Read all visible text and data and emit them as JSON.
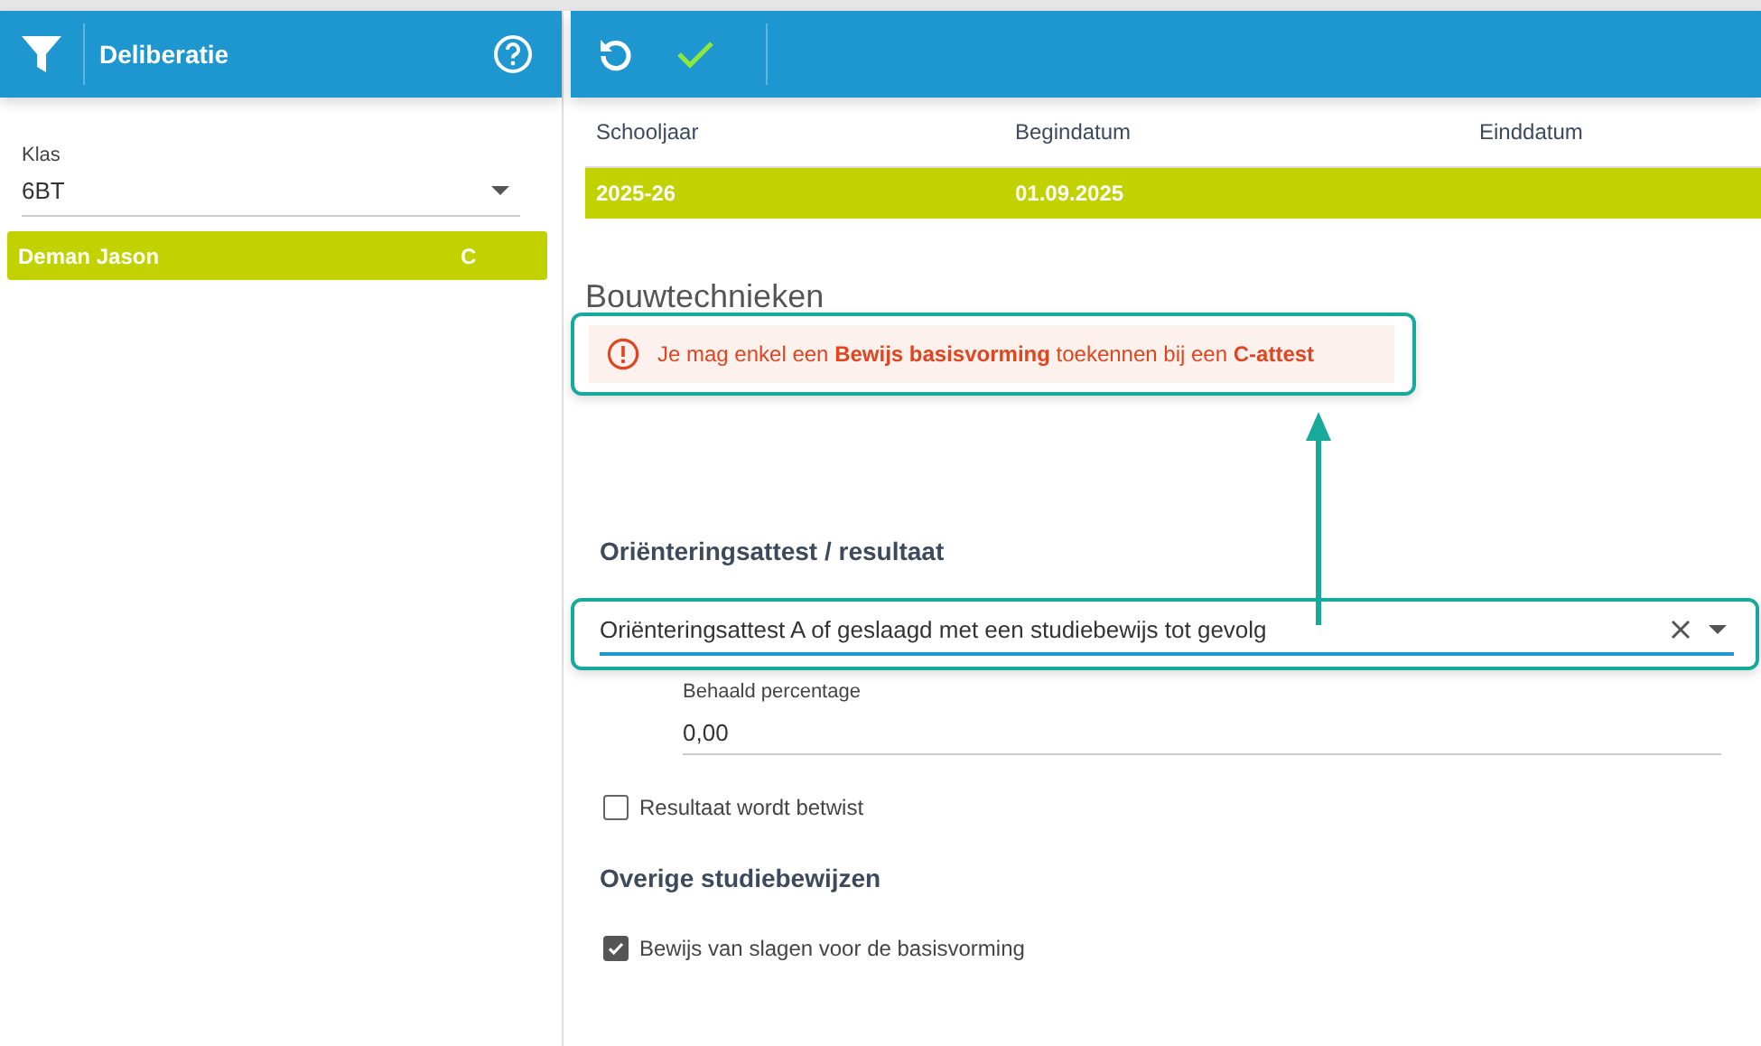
{
  "sidebar": {
    "title": "Deliberatie",
    "class_field": {
      "label": "Klas",
      "value": "6BT"
    },
    "students": [
      {
        "name": "Deman Jason",
        "grade": "C",
        "selected": true
      }
    ]
  },
  "period_table": {
    "columns": [
      "Schooljaar",
      "Begindatum",
      "Einddatum"
    ],
    "rows": [
      {
        "cells": [
          "2025-26",
          "01.09.2025"
        ],
        "selected": true
      }
    ]
  },
  "section_title": "Bouwtechnieken",
  "warning": {
    "message": "Je mag enkel een **Bewijs basisvorming** toekennen bij een **C-attest**"
  },
  "orientation": {
    "heading": "Oriënteringsattest / resultaat",
    "value": "Oriënteringsattest A of geslaagd met een studiebewijs tot gevolg",
    "percentage": {
      "label": "Behaald percentage",
      "value": "0,00"
    },
    "disputed": {
      "label": "Resultaat wordt betwist",
      "checked": false
    }
  },
  "other": {
    "heading": "Overige studiebewijzen",
    "items": [
      {
        "label": "Bewijs van slagen voor de basisvorming",
        "checked": true
      }
    ]
  }
}
